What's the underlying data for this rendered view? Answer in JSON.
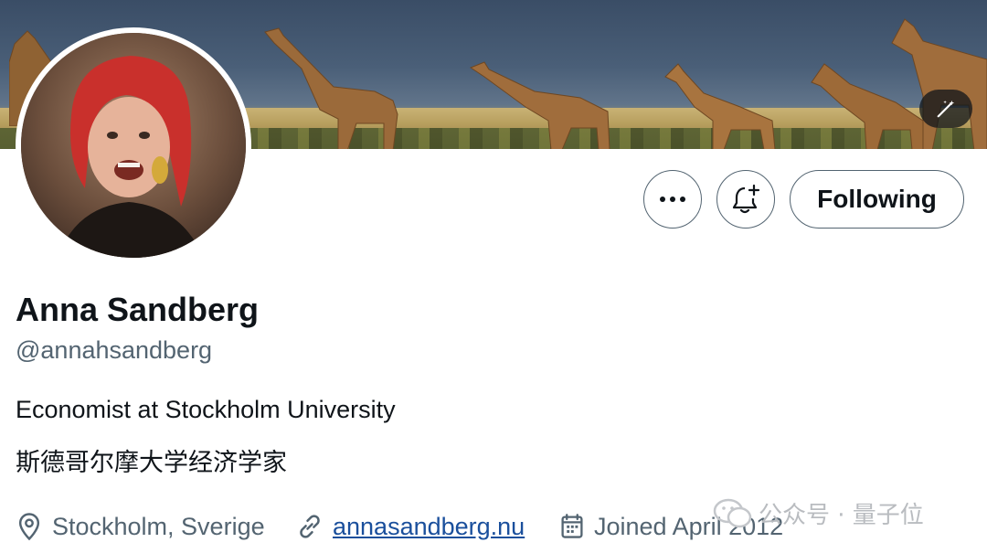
{
  "profile": {
    "name": "Anna Sandberg",
    "handle": "@annahsandberg",
    "bio_line1": "Economist at Stockholm University",
    "bio_line2": "斯德哥尔摩大学经济学家",
    "location": "Stockholm, Sverige",
    "website": "annasandberg.nu",
    "joined": "Joined April 2012"
  },
  "actions": {
    "more_icon": "more-dots-icon",
    "notify_icon": "bell-plus-icon",
    "follow_label": "Following"
  },
  "banner": {
    "edit_icon": "magic-wand-icon"
  },
  "icons": {
    "location": "location-pin-icon",
    "link": "link-icon",
    "calendar": "calendar-icon"
  },
  "watermark": {
    "text": "公众号 · 量子位"
  },
  "colors": {
    "text_primary": "#0f1419",
    "text_secondary": "#536471",
    "link": "#1a4f9c",
    "border": "#536471"
  }
}
